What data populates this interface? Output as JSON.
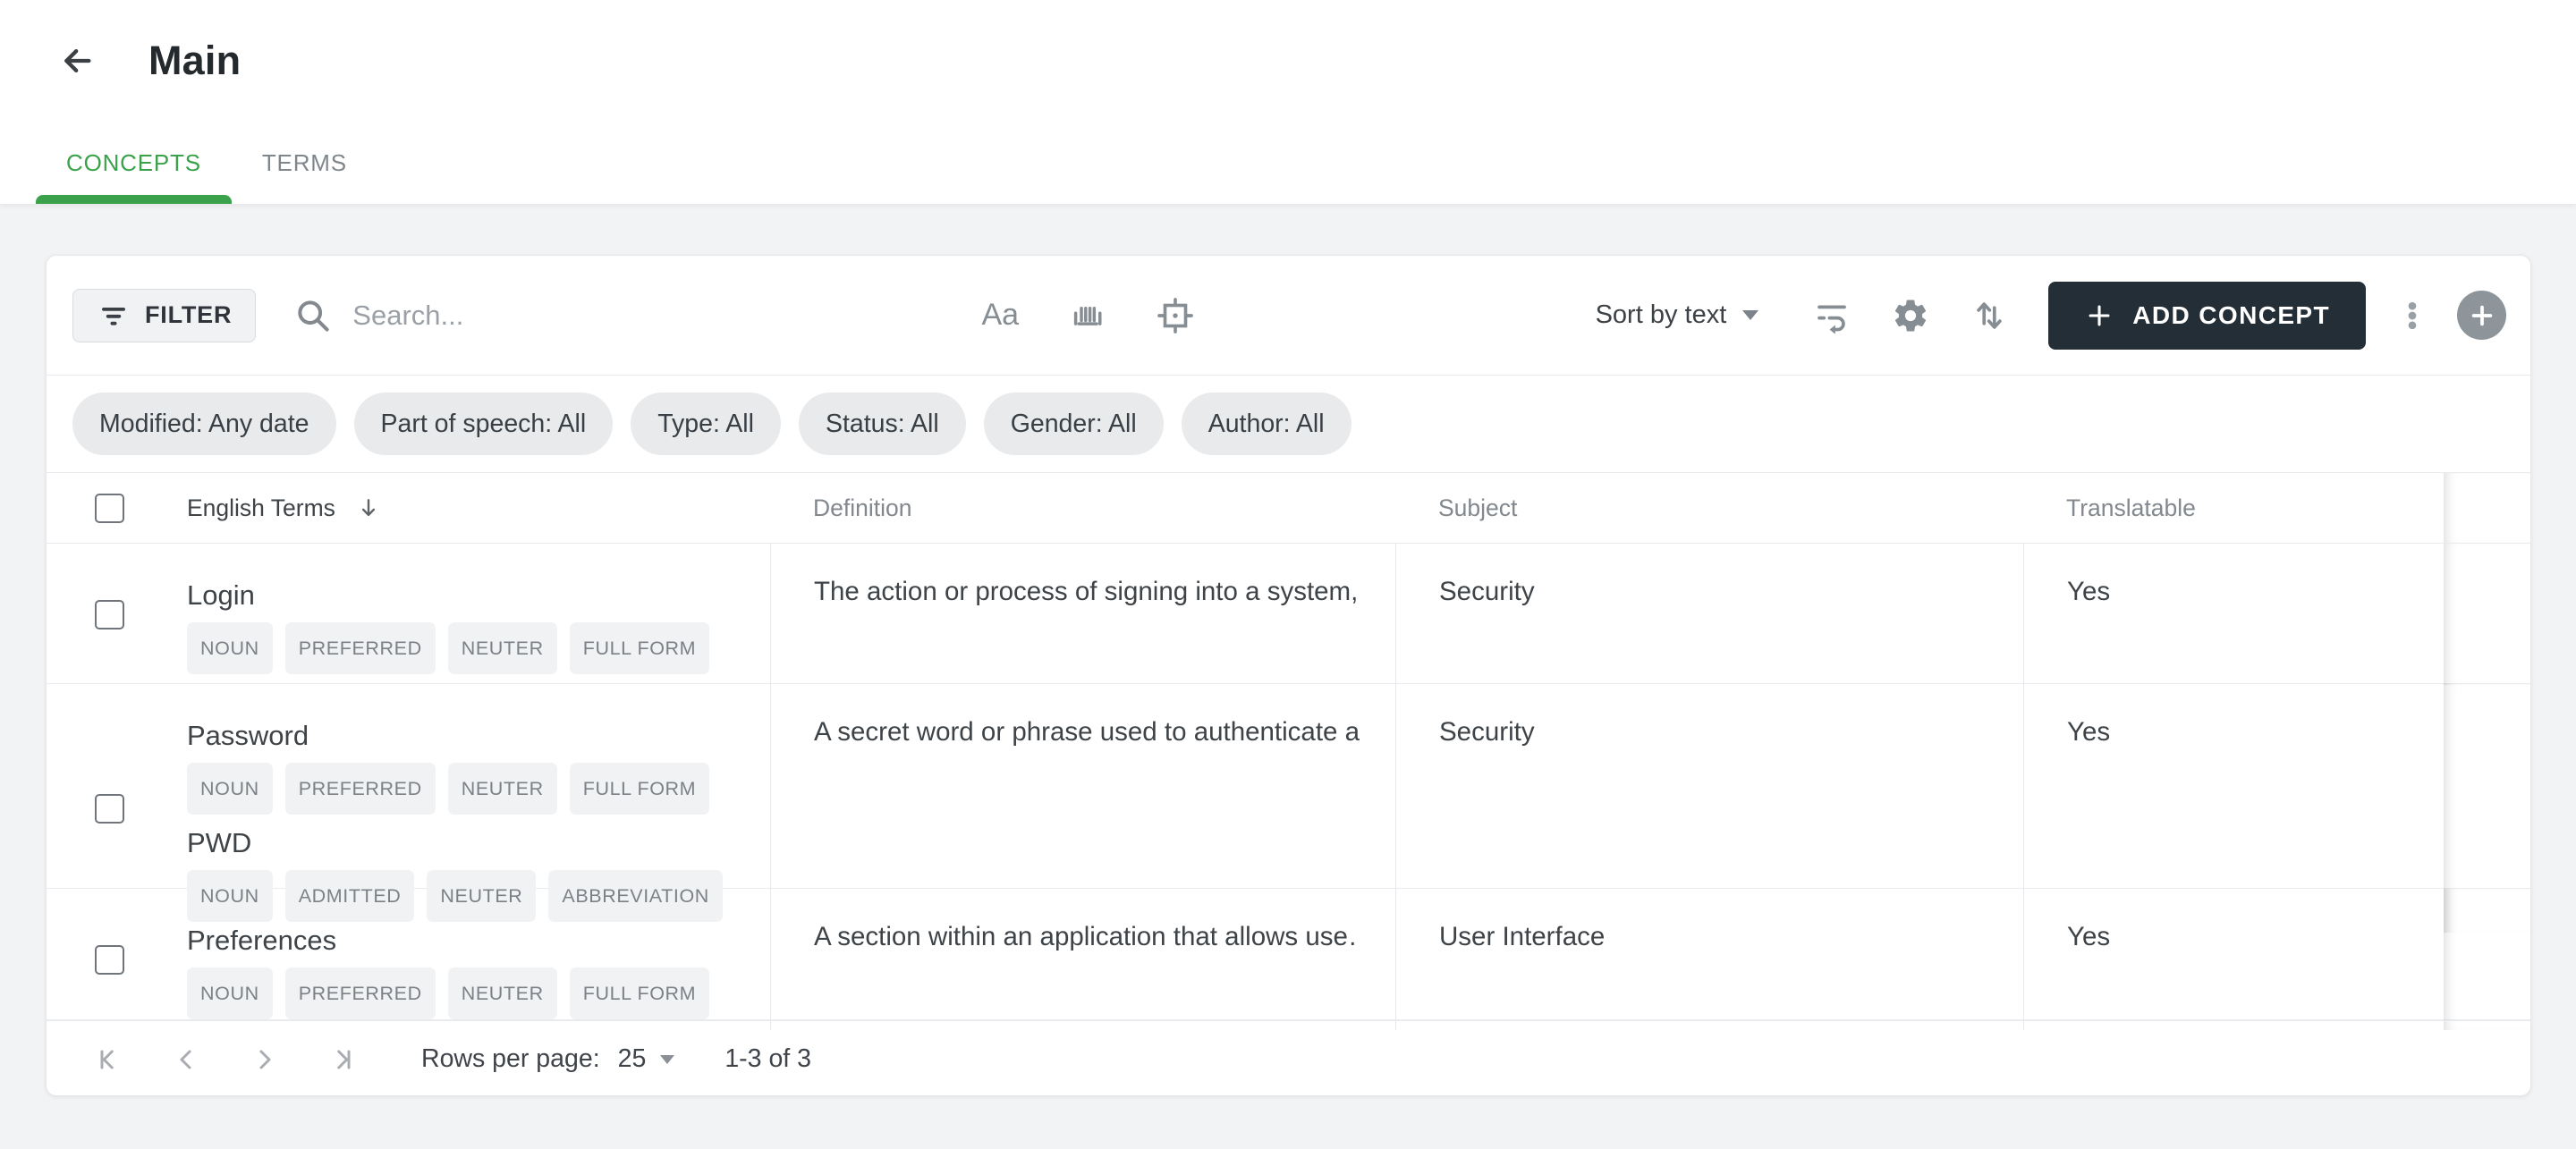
{
  "header": {
    "title": "Main"
  },
  "tabs": [
    {
      "label": "CONCEPTS",
      "active": true
    },
    {
      "label": "TERMS",
      "active": false
    }
  ],
  "toolbar": {
    "filter_label": "FILTER",
    "search_placeholder": "Search...",
    "match_case_label": "Aa",
    "sort_label": "Sort by text",
    "add_button_label": "ADD CONCEPT",
    "icons": [
      "filter-icon",
      "search-icon",
      "match-case-icon",
      "barcode-icon",
      "crosshair-icon",
      "wrap-text-icon",
      "gear-icon",
      "swap-vert-icon",
      "plus-icon",
      "kebab-icon",
      "plus-circle-icon"
    ]
  },
  "filters": {
    "modified": "Modified: Any date",
    "part_of_speech": "Part of speech: All",
    "type": "Type: All",
    "status": "Status: All",
    "gender": "Gender: All",
    "author": "Author: All"
  },
  "table": {
    "columns": [
      "English Terms",
      "Definition",
      "Subject",
      "Translatable"
    ],
    "rows": [
      {
        "terms": [
          {
            "text": "Login",
            "badges": [
              "NOUN",
              "PREFERRED",
              "NEUTER",
              "FULL FORM"
            ]
          }
        ],
        "definition": "The action or process of signing into a system,…",
        "subject": "Security",
        "translatable": "Yes"
      },
      {
        "terms": [
          {
            "text": "Password",
            "badges": [
              "NOUN",
              "PREFERRED",
              "NEUTER",
              "FULL FORM"
            ]
          },
          {
            "text": "PWD",
            "badges": [
              "NOUN",
              "ADMITTED",
              "NEUTER",
              "ABBREVIATION"
            ]
          }
        ],
        "definition": "A secret word or phrase used to authenticate a…",
        "subject": "Security",
        "translatable": "Yes"
      },
      {
        "terms": [
          {
            "text": "Preferences",
            "badges": [
              "NOUN",
              "PREFERRED",
              "NEUTER",
              "FULL FORM"
            ]
          }
        ],
        "definition": "A section within an application that allows use…",
        "subject": "User Interface",
        "translatable": "Yes"
      }
    ]
  },
  "pagination": {
    "rows_per_page_label": "Rows per page:",
    "rows_per_page_value": "25",
    "range_label": "1-3 of 3"
  },
  "colors": {
    "accent_green": "#3BA24B",
    "add_button_bg": "#232E36",
    "chip_bg": "#E9EAEC",
    "badge_bg": "#F1F2F4",
    "page_bg": "#F2F3F5"
  }
}
